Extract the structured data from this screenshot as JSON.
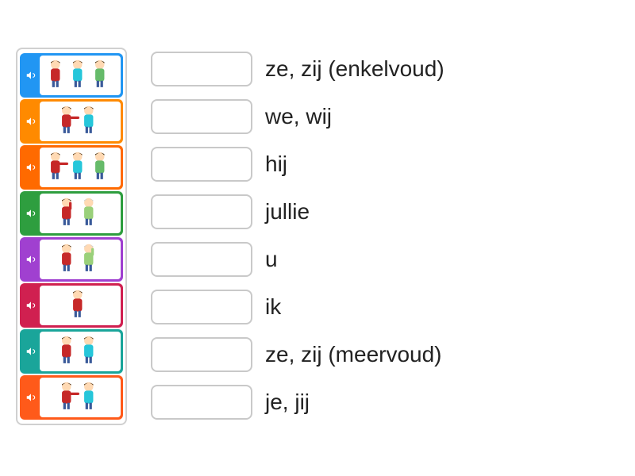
{
  "cards": [
    {
      "color": "#2196f3",
      "icon": "speaker-icon",
      "people": [
        "red",
        "teal",
        "green-f"
      ]
    },
    {
      "color": "#ff8a00",
      "icon": "speaker-icon",
      "people": [
        "red-point",
        "teal"
      ]
    },
    {
      "color": "#ff6a00",
      "icon": "speaker-icon",
      "people": [
        "red-point",
        "teal",
        "green-f"
      ]
    },
    {
      "color": "#2e9e3f",
      "icon": "speaker-icon",
      "people": [
        "red-wave",
        "old"
      ]
    },
    {
      "color": "#a040d0",
      "icon": "speaker-icon",
      "people": [
        "red",
        "old-wave"
      ]
    },
    {
      "color": "#d02050",
      "icon": "speaker-icon",
      "people": [
        "red-self"
      ]
    },
    {
      "color": "#1aa59a",
      "icon": "speaker-icon",
      "people": [
        "red",
        "teal"
      ]
    },
    {
      "color": "#ff5a1a",
      "icon": "speaker-icon",
      "people": [
        "red-point",
        "teal"
      ]
    }
  ],
  "rows": [
    {
      "label": "ze, zij (enkelvoud)"
    },
    {
      "label": "we, wij"
    },
    {
      "label": "hij"
    },
    {
      "label": "jullie"
    },
    {
      "label": "u"
    },
    {
      "label": "ik"
    },
    {
      "label": "ze, zij (meervoud)"
    },
    {
      "label": "je, jij"
    }
  ]
}
